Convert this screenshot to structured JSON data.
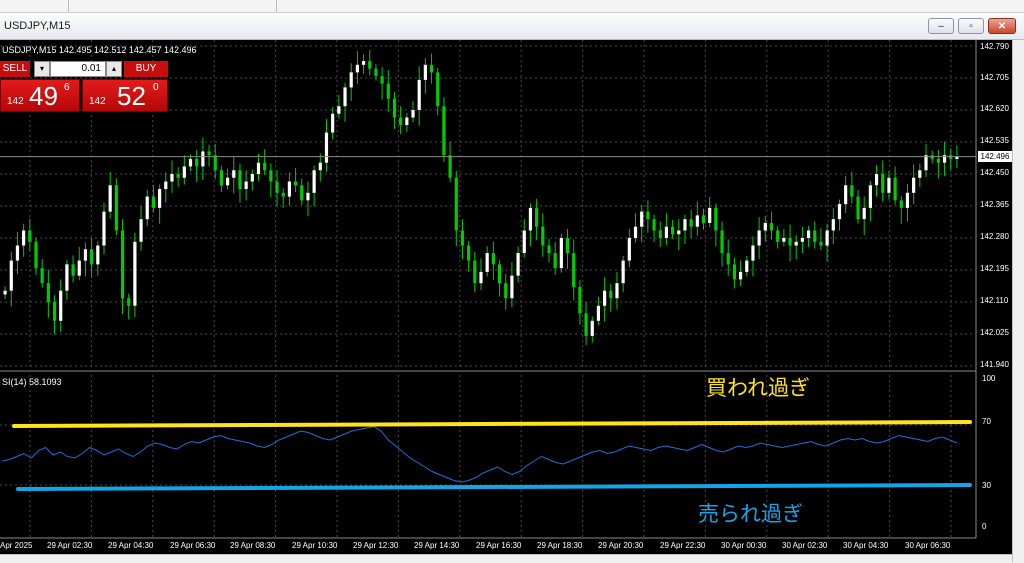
{
  "window": {
    "title": "USDJPY,M15",
    "minimize_glyph": "‒",
    "restore_glyph": "▫",
    "close_glyph": "✕"
  },
  "chart": {
    "header": "USDJPY,M15  142.495 142.512 142.457 142.496",
    "current_price": "142.496",
    "price_axis": [
      "142.790",
      "142.705",
      "142.620",
      "142.535",
      "142.450",
      "142.365",
      "142.280",
      "142.195",
      "142.110",
      "142.025",
      "141.940"
    ],
    "time_axis": [
      "Apr 2025",
      "29 Apr 02:30",
      "29 Apr 04:30",
      "29 Apr 06:30",
      "29 Apr 08:30",
      "29 Apr 10:30",
      "29 Apr 12:30",
      "29 Apr 14:30",
      "29 Apr 16:30",
      "29 Apr 18:30",
      "29 Apr 20:30",
      "29 Apr 22:30",
      "30 Apr 00:30",
      "30 Apr 02:30",
      "30 Apr 04:30",
      "30 Apr 06:30"
    ],
    "colors": {
      "background": "#000000",
      "bull": "#ffffff",
      "bear": "#00cc00",
      "grid": "#4a4a4a",
      "rsi_line": "#1e6fd9",
      "overbought": "#ffe41a",
      "oversold": "#13a5e8"
    }
  },
  "trade_panel": {
    "sell_label": "SELL",
    "buy_label": "BUY",
    "lot_size": "0.01",
    "dropdown_glyph": "▾",
    "up_glyph": "▴",
    "sell_prefix": "142",
    "sell_big": "49",
    "sell_sup": "6",
    "buy_prefix": "142",
    "buy_big": "52",
    "buy_sup": "0"
  },
  "rsi": {
    "header": "SI(14) 58.1093",
    "levels": [
      "100",
      "70",
      "30",
      "0"
    ],
    "overbought_label": "買われ過ぎ",
    "oversold_label": "売られ過ぎ"
  },
  "chart_data": {
    "type": "candlestick",
    "symbol": "USDJPY",
    "timeframe": "M15",
    "ylim": [
      141.94,
      142.79
    ],
    "ohlc_last": {
      "open": 142.495,
      "high": 142.512,
      "low": 142.457,
      "close": 142.496
    },
    "closes": [
      142.14,
      142.22,
      142.26,
      142.3,
      142.27,
      142.2,
      142.16,
      142.11,
      142.06,
      142.14,
      142.21,
      142.18,
      142.22,
      142.25,
      142.21,
      142.26,
      142.35,
      142.42,
      142.3,
      142.12,
      142.1,
      142.27,
      142.33,
      142.39,
      142.36,
      142.41,
      142.43,
      142.45,
      142.44,
      142.47,
      142.49,
      142.47,
      142.51,
      142.5,
      142.46,
      142.42,
      142.44,
      142.46,
      142.41,
      142.43,
      142.45,
      142.48,
      142.46,
      142.43,
      142.4,
      142.39,
      142.43,
      142.42,
      142.38,
      142.4,
      142.46,
      142.48,
      142.56,
      142.61,
      142.63,
      142.68,
      142.72,
      142.74,
      142.75,
      142.73,
      142.71,
      142.69,
      142.65,
      142.6,
      142.58,
      142.6,
      142.62,
      142.7,
      142.74,
      142.72,
      142.63,
      142.5,
      142.44,
      142.3,
      142.26,
      142.22,
      142.16,
      142.19,
      142.24,
      142.21,
      142.16,
      142.12,
      142.18,
      142.24,
      142.3,
      142.36,
      142.31,
      142.26,
      142.24,
      142.2,
      142.28,
      142.24,
      142.15,
      142.08,
      142.02,
      142.06,
      142.1,
      142.14,
      142.12,
      142.16,
      142.22,
      142.28,
      142.31,
      142.35,
      142.33,
      142.3,
      142.28,
      142.31,
      142.29,
      142.3,
      142.33,
      142.31,
      142.34,
      142.32,
      142.36,
      142.3,
      142.24,
      142.21,
      142.17,
      142.19,
      142.22,
      142.26,
      142.3,
      142.32,
      142.3,
      142.27,
      142.28,
      142.26,
      142.27,
      142.28,
      142.3,
      142.27,
      142.26,
      142.3,
      142.33,
      142.37,
      142.42,
      142.39,
      142.33,
      142.36,
      142.42,
      142.45,
      142.4,
      142.44,
      142.38,
      142.36,
      142.4,
      142.44,
      142.46,
      142.5,
      142.49,
      142.48,
      142.5,
      142.49,
      142.496
    ],
    "rsi_period": 14,
    "rsi_value": 58.1093,
    "rsi_levels": [
      70,
      30
    ],
    "rsi_ylim": [
      0,
      100
    ],
    "rsi_values": [
      46,
      47,
      49,
      51,
      48,
      53,
      55,
      50,
      52,
      49,
      48,
      51,
      55,
      53,
      50,
      52,
      54,
      51,
      49,
      52,
      56,
      58,
      57,
      55,
      54,
      57,
      59,
      58,
      60,
      62,
      63,
      61,
      60,
      59,
      58,
      56,
      55,
      57,
      60,
      62,
      64,
      66,
      65,
      63,
      61,
      60,
      62,
      64,
      66,
      67,
      68,
      69,
      66,
      60,
      56,
      52,
      48,
      45,
      42,
      39,
      37,
      35,
      33,
      32,
      33,
      35,
      38,
      40,
      42,
      39,
      37,
      39,
      43,
      46,
      49,
      47,
      45,
      44,
      46,
      48,
      50,
      52,
      53,
      51,
      52,
      54,
      56,
      55,
      54,
      53,
      55,
      56,
      55,
      54,
      53,
      55,
      57,
      55,
      53,
      52,
      54,
      56,
      55,
      56,
      58,
      57,
      56,
      55,
      56,
      57,
      58,
      59,
      57,
      56,
      58,
      60,
      61,
      60,
      61,
      59,
      58,
      59,
      61,
      63,
      62,
      61,
      60,
      59,
      61,
      62,
      60,
      58
    ]
  }
}
